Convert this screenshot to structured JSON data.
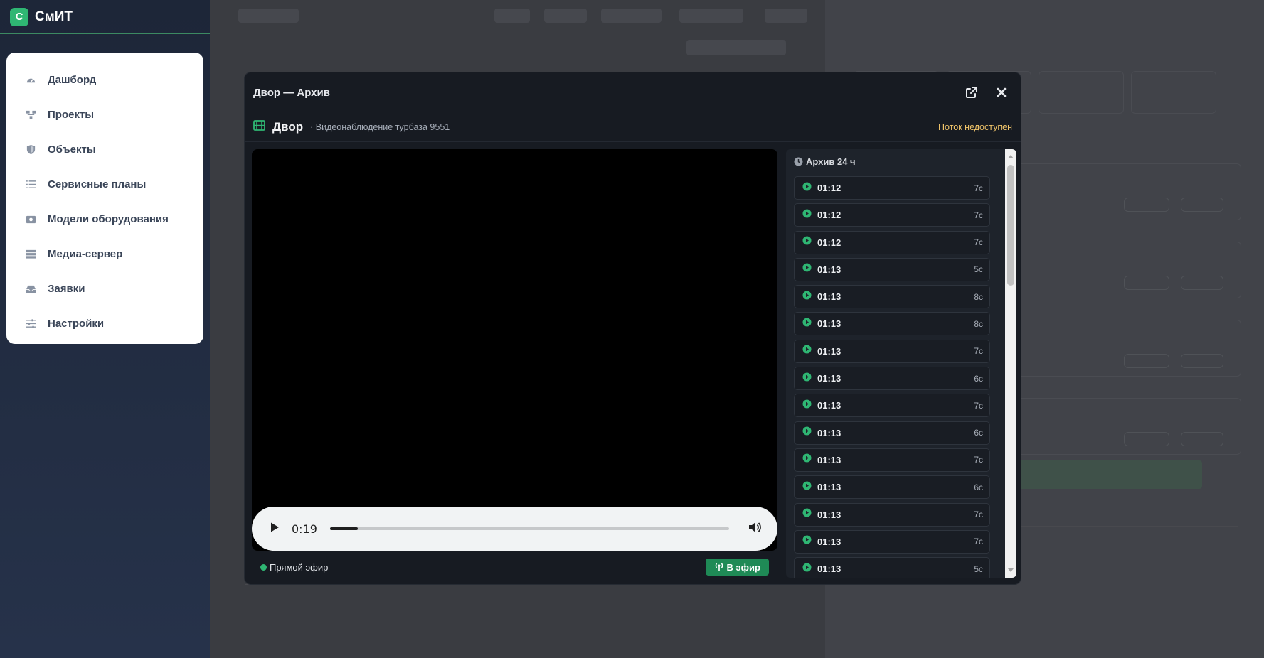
{
  "app": {
    "logo_letter": "С",
    "name": "СмИТ"
  },
  "sidebar": {
    "items": [
      {
        "label": "Дашборд",
        "icon": "gauge-icon"
      },
      {
        "label": "Проекты",
        "icon": "diagram-icon"
      },
      {
        "label": "Объекты",
        "icon": "shield-icon"
      },
      {
        "label": "Сервисные планы",
        "icon": "list-icon"
      },
      {
        "label": "Модели оборудования",
        "icon": "camera-box-icon"
      },
      {
        "label": "Медиа-сервер",
        "icon": "server-icon"
      },
      {
        "label": "Заявки",
        "icon": "inbox-icon"
      },
      {
        "label": "Настройки",
        "icon": "sliders-icon"
      }
    ]
  },
  "modal": {
    "title": "Двор — Архив",
    "camera_name": "Двор",
    "camera_site": "· Видеонаблюдение турбаза 9551",
    "stream_status": "Поток недоступен",
    "player": {
      "time": "0:19",
      "progress": 0.07
    },
    "live": {
      "label": "Прямой эфир",
      "button": "В эфир"
    },
    "archive": {
      "title": "Архив 24 ч",
      "items": [
        {
          "time": "01:12",
          "duration": "7с"
        },
        {
          "time": "01:12",
          "duration": "7с"
        },
        {
          "time": "01:12",
          "duration": "7с"
        },
        {
          "time": "01:13",
          "duration": "5с"
        },
        {
          "time": "01:13",
          "duration": "8с"
        },
        {
          "time": "01:13",
          "duration": "8с"
        },
        {
          "time": "01:13",
          "duration": "7с"
        },
        {
          "time": "01:13",
          "duration": "6с"
        },
        {
          "time": "01:13",
          "duration": "7с"
        },
        {
          "time": "01:13",
          "duration": "6с"
        },
        {
          "time": "01:13",
          "duration": "7с"
        },
        {
          "time": "01:13",
          "duration": "6с"
        },
        {
          "time": "01:13",
          "duration": "7с"
        },
        {
          "time": "01:13",
          "duration": "7с"
        },
        {
          "time": "01:13",
          "duration": "5с"
        }
      ]
    }
  },
  "colors": {
    "accent": "#2fb673",
    "warning": "#f1c56a",
    "live_button": "#1f8a56"
  }
}
